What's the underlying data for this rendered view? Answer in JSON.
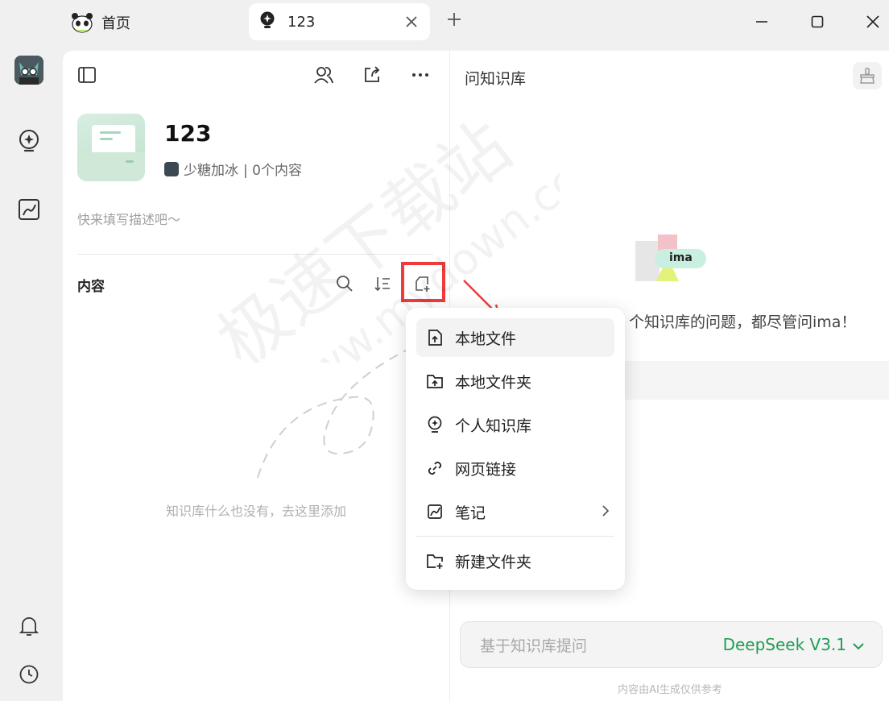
{
  "tabs": {
    "home_label": "首页",
    "active_label": "123"
  },
  "knowledge_base": {
    "title": "123",
    "owner": "少糖加冰",
    "meta_suffix": "| 0个内容",
    "description_placeholder": "快来填写描述吧～",
    "section_title": "内容",
    "empty_text": "知识库什么也没有，去这里添加"
  },
  "right_panel": {
    "title": "问知识库",
    "greeting": "个知识库的问题，都尽管问ima！",
    "logo_text": "ima",
    "ask_placeholder": "基于知识库提问",
    "model": "DeepSeek V3.1",
    "disclaimer": "内容由AI生成仅供参考"
  },
  "menu": {
    "items": [
      {
        "label": "本地文件",
        "icon": "file-upload-icon"
      },
      {
        "label": "本地文件夹",
        "icon": "folder-upload-icon"
      },
      {
        "label": "个人知识库",
        "icon": "bulb-icon"
      },
      {
        "label": "网页链接",
        "icon": "link-icon"
      },
      {
        "label": "笔记",
        "icon": "note-icon"
      },
      {
        "label": "新建文件夹",
        "icon": "folder-add-icon"
      }
    ]
  },
  "watermark": {
    "line1": "极速下载站",
    "line2": "www.mydown.com"
  },
  "colors": {
    "accent_green": "#1f9e55",
    "highlight_red": "#ef3b3b"
  }
}
